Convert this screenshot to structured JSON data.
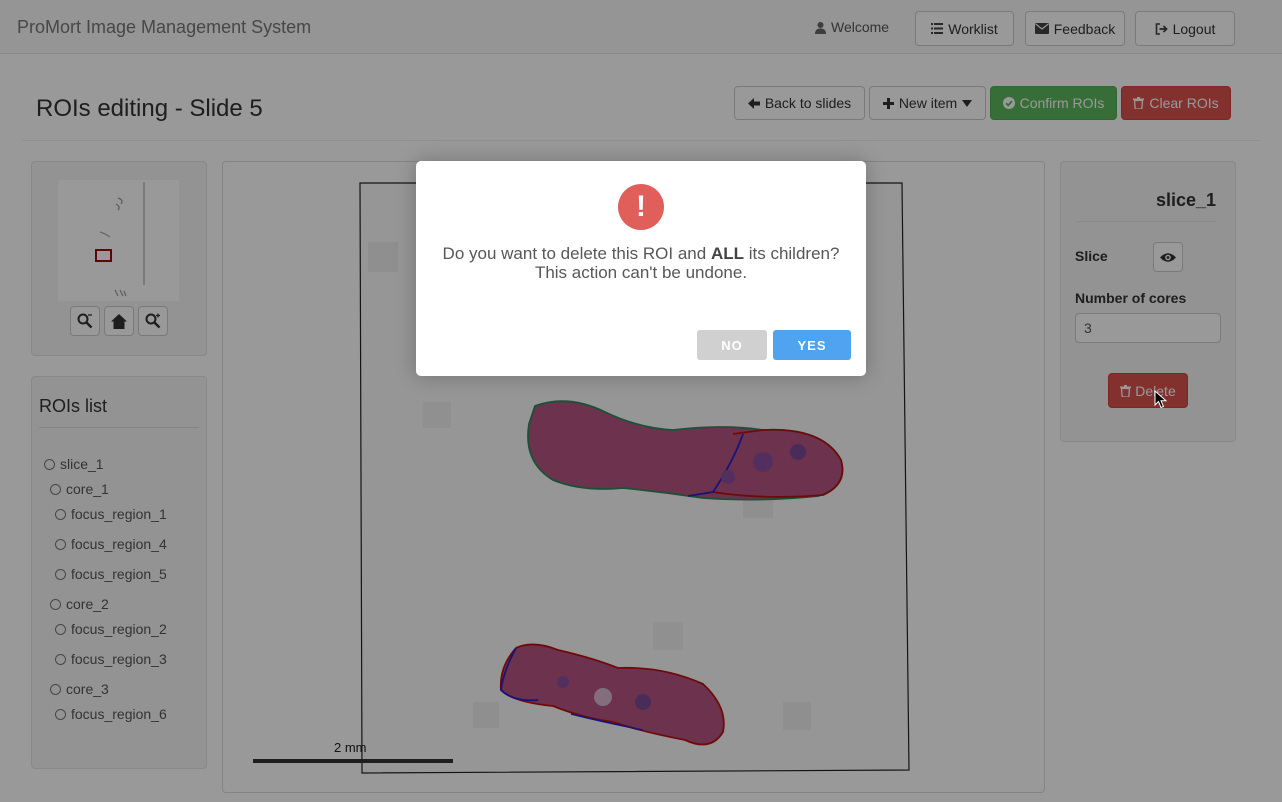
{
  "app": {
    "title": "ProMort Image Management System"
  },
  "nav": {
    "welcome": "Welcome",
    "worklist": "Worklist",
    "feedback": "Feedback",
    "logout": "Logout"
  },
  "page": {
    "title": "ROIs editing - Slide 5"
  },
  "toolbar": {
    "back": "Back to slides",
    "new_item": "New item",
    "confirm": "Confirm ROIs",
    "clear": "Clear ROIs"
  },
  "rois": {
    "title": "ROIs list",
    "items": [
      {
        "label": "slice_1"
      },
      {
        "label": "core_1"
      },
      {
        "label": "focus_region_1"
      },
      {
        "label": "focus_region_4"
      },
      {
        "label": "focus_region_5"
      },
      {
        "label": "core_2"
      },
      {
        "label": "focus_region_2"
      },
      {
        "label": "focus_region_3"
      },
      {
        "label": "core_3"
      },
      {
        "label": "focus_region_6"
      }
    ]
  },
  "viewer": {
    "scale_label": "2 mm"
  },
  "details": {
    "title": "slice_1",
    "slice_label": "Slice",
    "cores_label": "Number of cores",
    "cores_value": "3",
    "delete": "Delete"
  },
  "dialog": {
    "line1_a": "Do you want to delete this ROI and",
    "line1_b": "ALL",
    "line1_c": "its children?",
    "line2": "This action can't be undone.",
    "no": "NO",
    "yes": "YES"
  },
  "colors": {
    "success": "#5cb85c",
    "danger": "#d9534f",
    "confirm_button": "#4fa3ef",
    "alert_icon": "#e05f5b"
  }
}
